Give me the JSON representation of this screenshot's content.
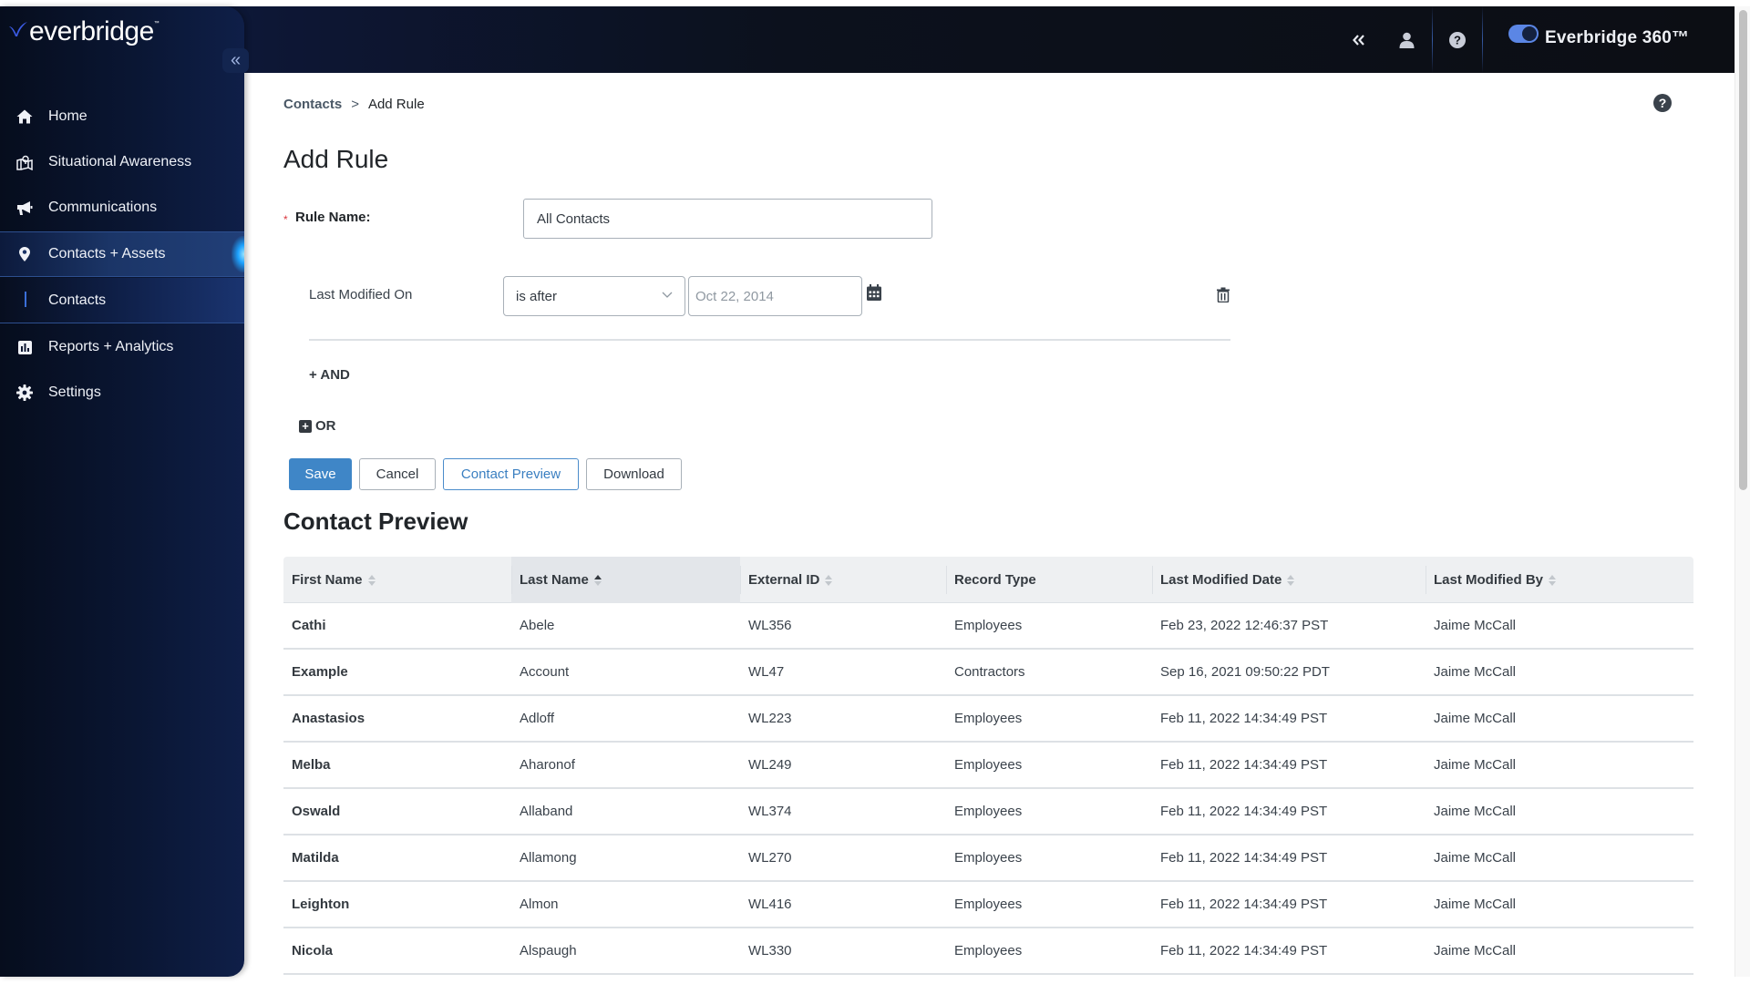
{
  "brand": {
    "logo_text": "everbridge",
    "logo_tm": "™",
    "product_name": "Everbridge 360™",
    "accent_color": "#3f86c7",
    "toggle_on": true
  },
  "header": {
    "collapse_icon": "double-chevron-left-icon",
    "user_icon": "user-icon",
    "help_icon": "help-circle-icon"
  },
  "sidebar": {
    "collapse_label": "«",
    "items": [
      {
        "label": "Home",
        "icon": "home-icon"
      },
      {
        "label": "Situational Awareness",
        "icon": "map-pin-icon"
      },
      {
        "label": "Communications",
        "icon": "megaphone-icon"
      },
      {
        "label": "Contacts + Assets",
        "icon": "location-pin-icon",
        "active": true
      },
      {
        "label": "Contacts",
        "sub": true,
        "active": true
      },
      {
        "label": "Reports + Analytics",
        "icon": "bar-chart-icon"
      },
      {
        "label": "Settings",
        "icon": "gear-icon"
      }
    ]
  },
  "breadcrumb": {
    "parent": "Contacts",
    "separator": ">",
    "current": "Add Rule"
  },
  "page": {
    "title": "Add Rule",
    "help_icon": "?",
    "rule_name_required": "*",
    "rule_name_label": "Rule Name:",
    "rule_name_value": "All Contacts",
    "condition": {
      "field_label": "Last Modified On",
      "operator_value": "is after",
      "date_value": "Oct 22, 2014"
    },
    "and_label": "+ AND",
    "or_icon": "+",
    "or_label": "OR"
  },
  "actions": {
    "save": "Save",
    "cancel": "Cancel",
    "contact_preview": "Contact Preview",
    "download": "Download"
  },
  "preview": {
    "title": "Contact Preview",
    "columns": [
      {
        "label": "First Name",
        "sortable": true,
        "sort": "none"
      },
      {
        "label": "Last Name",
        "sortable": true,
        "sort": "asc"
      },
      {
        "label": "External ID",
        "sortable": true,
        "sort": "none"
      },
      {
        "label": "Record Type",
        "sortable": false
      },
      {
        "label": "Last Modified Date",
        "sortable": true,
        "sort": "none"
      },
      {
        "label": "Last Modified By",
        "sortable": true,
        "sort": "none"
      }
    ],
    "rows": [
      [
        "Cathi",
        "Abele",
        "WL356",
        "Employees",
        "Feb 23, 2022 12:46:37 PST",
        "Jaime McCall"
      ],
      [
        "Example",
        "Account",
        "WL47",
        "Contractors",
        "Sep 16, 2021 09:50:22 PDT",
        "Jaime McCall"
      ],
      [
        "Anastasios",
        "Adloff",
        "WL223",
        "Employees",
        "Feb 11, 2022 14:34:49 PST",
        "Jaime McCall"
      ],
      [
        "Melba",
        "Aharonof",
        "WL249",
        "Employees",
        "Feb 11, 2022 14:34:49 PST",
        "Jaime McCall"
      ],
      [
        "Oswald",
        "Allaband",
        "WL374",
        "Employees",
        "Feb 11, 2022 14:34:49 PST",
        "Jaime McCall"
      ],
      [
        "Matilda",
        "Allamong",
        "WL270",
        "Employees",
        "Feb 11, 2022 14:34:49 PST",
        "Jaime McCall"
      ],
      [
        "Leighton",
        "Almon",
        "WL416",
        "Employees",
        "Feb 11, 2022 14:34:49 PST",
        "Jaime McCall"
      ],
      [
        "Nicola",
        "Alspaugh",
        "WL330",
        "Employees",
        "Feb 11, 2022 14:34:49 PST",
        "Jaime McCall"
      ]
    ]
  }
}
